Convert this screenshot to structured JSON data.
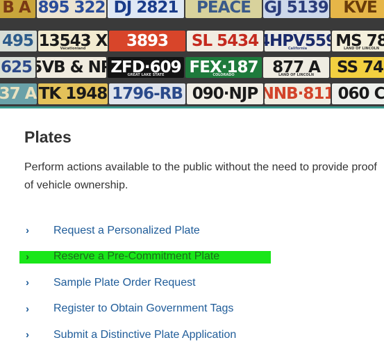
{
  "banner": {
    "plates": [
      [
        {
          "text": "B A",
          "bg": "#c9a53b",
          "fg": "#7a3a14",
          "w": 55
        },
        {
          "text": "895 322",
          "bg": "#ece4d2",
          "fg": "#2a4c9a",
          "w": 100
        },
        {
          "text": "DJ 2821",
          "bg": "#dfe8f4",
          "fg": "#1a3c8a",
          "w": 110
        },
        {
          "text": "PEACE",
          "bg": "#d8d29c",
          "fg": "#3a5a8a",
          "w": 110
        },
        {
          "text": "GJ 5139",
          "bg": "#cdd8ea",
          "fg": "#2a3c7a",
          "w": 95
        },
        {
          "text": "KVE",
          "bg": "#e6b648",
          "fg": "#6a3c0a",
          "w": 85
        }
      ],
      [
        {
          "text": "495",
          "bg": "#d8ded6",
          "fg": "#2c5b8a",
          "w": 55
        },
        {
          "text": "13543 X",
          "bg": "#f3ebd0",
          "fg": "#1a1a1a",
          "w": 100,
          "sub": "Vacationland"
        },
        {
          "text": "3893",
          "bg": "#d8452a",
          "fg": "#ffffff",
          "w": 110
        },
        {
          "text": "SL 5434",
          "bg": "#f2ede2",
          "fg": "#c42a1e",
          "w": 110
        },
        {
          "text": "4HPV559",
          "bg": "#ecebe5",
          "fg": "#1a2a6a",
          "w": 95,
          "sub": "California"
        },
        {
          "text": "MS 78",
          "bg": "#f4f0dc",
          "fg": "#1a1a1a",
          "w": 85,
          "sub": "LAND OF LINCOLN"
        }
      ],
      [
        {
          "text": "625",
          "bg": "#dbe0d8",
          "fg": "#2c4a8a",
          "w": 55
        },
        {
          "text": "5VB & NP",
          "bg": "#f1ece0",
          "fg": "#1a1a1a",
          "w": 100
        },
        {
          "text": "ZFD·609",
          "bg": "#131313",
          "fg": "#ffffff",
          "w": 110,
          "sub": "GREAT LAKE STATE"
        },
        {
          "text": "FEX·187",
          "bg": "#1e7a3c",
          "fg": "#ffffff",
          "w": 110,
          "sub": "COLORADO"
        },
        {
          "text": "877 A",
          "bg": "#efece2",
          "fg": "#1a1a1a",
          "w": 95,
          "sub": "LAND OF LINCOLN"
        },
        {
          "text": "SS 74",
          "bg": "#f2d040",
          "fg": "#1a1a1a",
          "w": 85
        }
      ],
      [
        {
          "text": "37 A",
          "bg": "#6aa1a8",
          "fg": "#e9e2c0",
          "w": 55
        },
        {
          "text": "TK 1948",
          "bg": "#e3c15a",
          "fg": "#1a1a1a",
          "w": 100
        },
        {
          "text": "1796-RB",
          "bg": "#dfe4ec",
          "fg": "#2a4a8a",
          "w": 110
        },
        {
          "text": "090·NJP",
          "bg": "#f1eee6",
          "fg": "#1a1a1a",
          "w": 110
        },
        {
          "text": "NNB·811",
          "bg": "#f1ece0",
          "fg": "#d2432a",
          "w": 95
        },
        {
          "text": "060 C",
          "bg": "#eef0ec",
          "fg": "#1a1a1a",
          "w": 85
        }
      ]
    ]
  },
  "section": {
    "title": "Plates",
    "description": "Perform actions available to the public without the need to provide proof of vehicle ownership."
  },
  "links": [
    {
      "label": "Request a Personalized Plate",
      "highlighted": false
    },
    {
      "label": "Reserve a Pre-Commitment Plate",
      "highlighted": true
    },
    {
      "label": "Sample Plate Order Request",
      "highlighted": false
    },
    {
      "label": "Register to Obtain Government Tags",
      "highlighted": false
    },
    {
      "label": "Submit a Distinctive Plate Application",
      "highlighted": false
    }
  ],
  "icons": {
    "link_chevron": "chevron-right-icon"
  },
  "colors": {
    "link": "#1f5c99",
    "highlight": "#19e619",
    "accent_line": "#3a9a8e",
    "title": "#333333"
  }
}
